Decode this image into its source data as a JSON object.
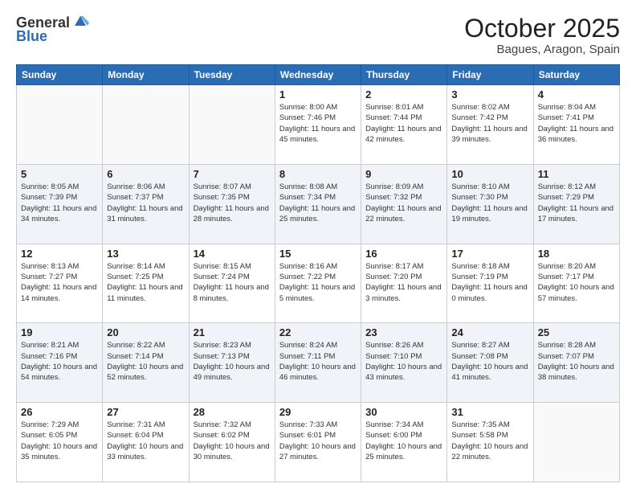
{
  "logo": {
    "general": "General",
    "blue": "Blue"
  },
  "header": {
    "month": "October 2025",
    "location": "Bagues, Aragon, Spain"
  },
  "weekdays": [
    "Sunday",
    "Monday",
    "Tuesday",
    "Wednesday",
    "Thursday",
    "Friday",
    "Saturday"
  ],
  "weeks": [
    [
      {
        "day": "",
        "sunrise": "",
        "sunset": "",
        "daylight": ""
      },
      {
        "day": "",
        "sunrise": "",
        "sunset": "",
        "daylight": ""
      },
      {
        "day": "",
        "sunrise": "",
        "sunset": "",
        "daylight": ""
      },
      {
        "day": "1",
        "sunrise": "Sunrise: 8:00 AM",
        "sunset": "Sunset: 7:46 PM",
        "daylight": "Daylight: 11 hours and 45 minutes."
      },
      {
        "day": "2",
        "sunrise": "Sunrise: 8:01 AM",
        "sunset": "Sunset: 7:44 PM",
        "daylight": "Daylight: 11 hours and 42 minutes."
      },
      {
        "day": "3",
        "sunrise": "Sunrise: 8:02 AM",
        "sunset": "Sunset: 7:42 PM",
        "daylight": "Daylight: 11 hours and 39 minutes."
      },
      {
        "day": "4",
        "sunrise": "Sunrise: 8:04 AM",
        "sunset": "Sunset: 7:41 PM",
        "daylight": "Daylight: 11 hours and 36 minutes."
      }
    ],
    [
      {
        "day": "5",
        "sunrise": "Sunrise: 8:05 AM",
        "sunset": "Sunset: 7:39 PM",
        "daylight": "Daylight: 11 hours and 34 minutes."
      },
      {
        "day": "6",
        "sunrise": "Sunrise: 8:06 AM",
        "sunset": "Sunset: 7:37 PM",
        "daylight": "Daylight: 11 hours and 31 minutes."
      },
      {
        "day": "7",
        "sunrise": "Sunrise: 8:07 AM",
        "sunset": "Sunset: 7:35 PM",
        "daylight": "Daylight: 11 hours and 28 minutes."
      },
      {
        "day": "8",
        "sunrise": "Sunrise: 8:08 AM",
        "sunset": "Sunset: 7:34 PM",
        "daylight": "Daylight: 11 hours and 25 minutes."
      },
      {
        "day": "9",
        "sunrise": "Sunrise: 8:09 AM",
        "sunset": "Sunset: 7:32 PM",
        "daylight": "Daylight: 11 hours and 22 minutes."
      },
      {
        "day": "10",
        "sunrise": "Sunrise: 8:10 AM",
        "sunset": "Sunset: 7:30 PM",
        "daylight": "Daylight: 11 hours and 19 minutes."
      },
      {
        "day": "11",
        "sunrise": "Sunrise: 8:12 AM",
        "sunset": "Sunset: 7:29 PM",
        "daylight": "Daylight: 11 hours and 17 minutes."
      }
    ],
    [
      {
        "day": "12",
        "sunrise": "Sunrise: 8:13 AM",
        "sunset": "Sunset: 7:27 PM",
        "daylight": "Daylight: 11 hours and 14 minutes."
      },
      {
        "day": "13",
        "sunrise": "Sunrise: 8:14 AM",
        "sunset": "Sunset: 7:25 PM",
        "daylight": "Daylight: 11 hours and 11 minutes."
      },
      {
        "day": "14",
        "sunrise": "Sunrise: 8:15 AM",
        "sunset": "Sunset: 7:24 PM",
        "daylight": "Daylight: 11 hours and 8 minutes."
      },
      {
        "day": "15",
        "sunrise": "Sunrise: 8:16 AM",
        "sunset": "Sunset: 7:22 PM",
        "daylight": "Daylight: 11 hours and 5 minutes."
      },
      {
        "day": "16",
        "sunrise": "Sunrise: 8:17 AM",
        "sunset": "Sunset: 7:20 PM",
        "daylight": "Daylight: 11 hours and 3 minutes."
      },
      {
        "day": "17",
        "sunrise": "Sunrise: 8:18 AM",
        "sunset": "Sunset: 7:19 PM",
        "daylight": "Daylight: 11 hours and 0 minutes."
      },
      {
        "day": "18",
        "sunrise": "Sunrise: 8:20 AM",
        "sunset": "Sunset: 7:17 PM",
        "daylight": "Daylight: 10 hours and 57 minutes."
      }
    ],
    [
      {
        "day": "19",
        "sunrise": "Sunrise: 8:21 AM",
        "sunset": "Sunset: 7:16 PM",
        "daylight": "Daylight: 10 hours and 54 minutes."
      },
      {
        "day": "20",
        "sunrise": "Sunrise: 8:22 AM",
        "sunset": "Sunset: 7:14 PM",
        "daylight": "Daylight: 10 hours and 52 minutes."
      },
      {
        "day": "21",
        "sunrise": "Sunrise: 8:23 AM",
        "sunset": "Sunset: 7:13 PM",
        "daylight": "Daylight: 10 hours and 49 minutes."
      },
      {
        "day": "22",
        "sunrise": "Sunrise: 8:24 AM",
        "sunset": "Sunset: 7:11 PM",
        "daylight": "Daylight: 10 hours and 46 minutes."
      },
      {
        "day": "23",
        "sunrise": "Sunrise: 8:26 AM",
        "sunset": "Sunset: 7:10 PM",
        "daylight": "Daylight: 10 hours and 43 minutes."
      },
      {
        "day": "24",
        "sunrise": "Sunrise: 8:27 AM",
        "sunset": "Sunset: 7:08 PM",
        "daylight": "Daylight: 10 hours and 41 minutes."
      },
      {
        "day": "25",
        "sunrise": "Sunrise: 8:28 AM",
        "sunset": "Sunset: 7:07 PM",
        "daylight": "Daylight: 10 hours and 38 minutes."
      }
    ],
    [
      {
        "day": "26",
        "sunrise": "Sunrise: 7:29 AM",
        "sunset": "Sunset: 6:05 PM",
        "daylight": "Daylight: 10 hours and 35 minutes."
      },
      {
        "day": "27",
        "sunrise": "Sunrise: 7:31 AM",
        "sunset": "Sunset: 6:04 PM",
        "daylight": "Daylight: 10 hours and 33 minutes."
      },
      {
        "day": "28",
        "sunrise": "Sunrise: 7:32 AM",
        "sunset": "Sunset: 6:02 PM",
        "daylight": "Daylight: 10 hours and 30 minutes."
      },
      {
        "day": "29",
        "sunrise": "Sunrise: 7:33 AM",
        "sunset": "Sunset: 6:01 PM",
        "daylight": "Daylight: 10 hours and 27 minutes."
      },
      {
        "day": "30",
        "sunrise": "Sunrise: 7:34 AM",
        "sunset": "Sunset: 6:00 PM",
        "daylight": "Daylight: 10 hours and 25 minutes."
      },
      {
        "day": "31",
        "sunrise": "Sunrise: 7:35 AM",
        "sunset": "Sunset: 5:58 PM",
        "daylight": "Daylight: 10 hours and 22 minutes."
      },
      {
        "day": "",
        "sunrise": "",
        "sunset": "",
        "daylight": ""
      }
    ]
  ]
}
